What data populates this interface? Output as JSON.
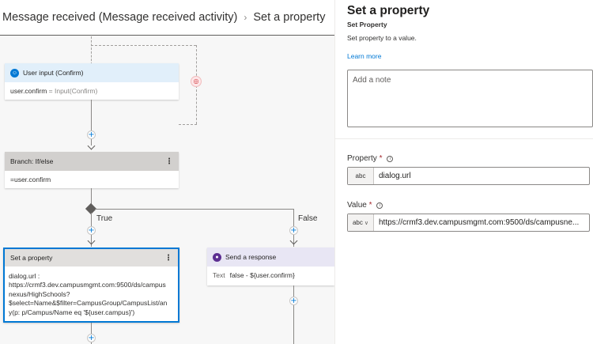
{
  "breadcrumb": {
    "parent": "Message received (Message received activity)",
    "current": "Set a property"
  },
  "nodes": {
    "user_input": {
      "title": "User input (Confirm)",
      "prop": "user.confirm",
      "expr": " = Input(Confirm)"
    },
    "branch": {
      "title": "Branch: If/else",
      "condition": "=user.confirm",
      "true_label": "True",
      "false_label": "False"
    },
    "set_property": {
      "title": "Set a property",
      "lines": [
        "dialog.url :",
        "https://crmf3.dev.campusmgmt.com:9500/ds/campus",
        "nexus/HighSchools?",
        "$select=Name&$filter=CampusGroup/CampusList/an",
        "y(p: p/Campus/Name eq '${user.campus}')"
      ]
    },
    "send_response": {
      "title": "Send a response",
      "text_label": "Text",
      "text_value": "false - ${user.confirm}"
    }
  },
  "panel": {
    "title": "Set a property",
    "subtitle": "Set Property",
    "description": "Set property to a value.",
    "learn_more": "Learn more",
    "note_placeholder": "Add a note",
    "property": {
      "label": "Property",
      "required": "*",
      "type": "abc",
      "value": "dialog.url"
    },
    "value": {
      "label": "Value",
      "required": "*",
      "type": "abc",
      "value": "https://crmf3.dev.campusmgmt.com:9500/ds/campusne..."
    }
  },
  "icons": {
    "user_input": "person-icon",
    "send_response": "chat-bubble-icon",
    "menu": "more-vertical-icon",
    "info": "info-icon",
    "type_dropdown": "chevron-down-icon"
  },
  "colors": {
    "accent": "#0078d4",
    "send_response_icon": "#5c2e91",
    "selected_border": "#0078d4"
  }
}
